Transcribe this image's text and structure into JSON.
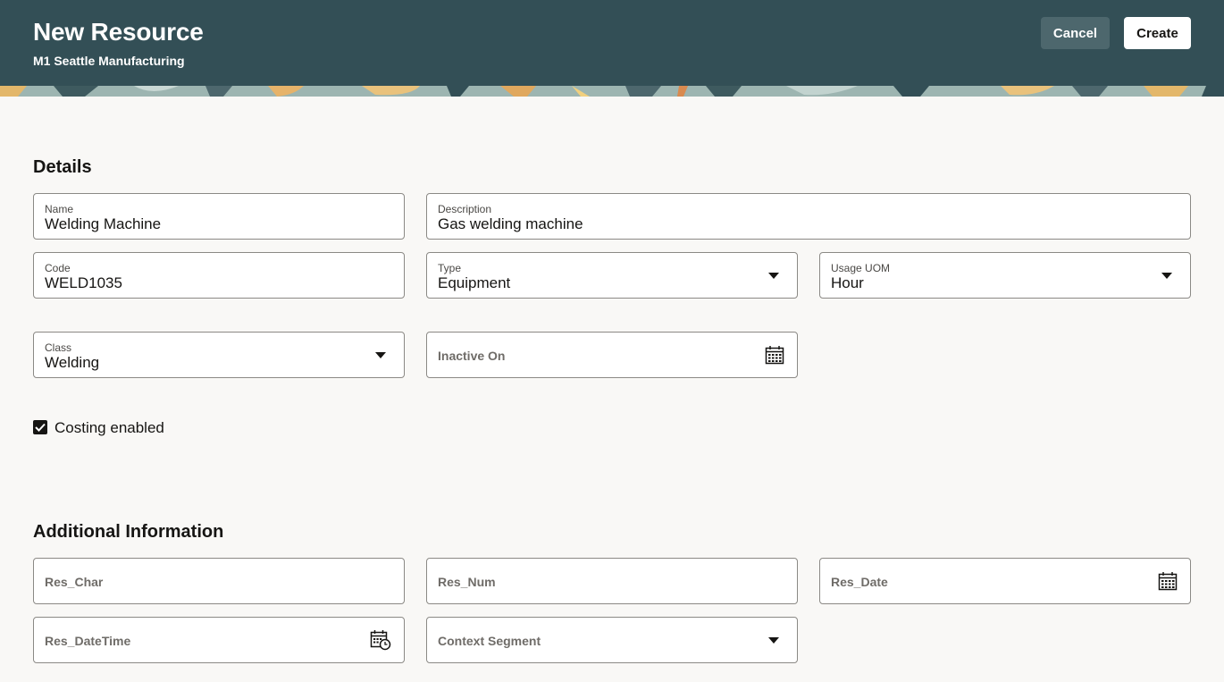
{
  "header": {
    "title": "New Resource",
    "subtitle": "M1 Seattle Manufacturing",
    "cancel_label": "Cancel",
    "create_label": "Create"
  },
  "details": {
    "title": "Details",
    "name": {
      "label": "Name",
      "value": "Welding Machine"
    },
    "description": {
      "label": "Description",
      "value": "Gas welding machine"
    },
    "code": {
      "label": "Code",
      "value": "WELD1035"
    },
    "type": {
      "label": "Type",
      "value": "Equipment"
    },
    "usage_uom": {
      "label": "Usage UOM",
      "value": "Hour"
    },
    "class": {
      "label": "Class",
      "value": "Welding"
    },
    "inactive_on": {
      "label": "Inactive On",
      "value": ""
    },
    "costing_enabled": {
      "label": "Costing enabled",
      "checked": true
    }
  },
  "additional": {
    "title": "Additional Information",
    "res_char": {
      "label": "Res_Char"
    },
    "res_num": {
      "label": "Res_Num"
    },
    "res_date": {
      "label": "Res_Date"
    },
    "res_datetime": {
      "label": "Res_DateTime"
    },
    "context_segment": {
      "label": "Context Segment"
    }
  },
  "colors": {
    "header_bg": "#334f56",
    "page_bg": "#f9f8f6",
    "field_border": "#8b8985"
  },
  "icons": [
    "calendar-icon",
    "calendar-clock-icon",
    "chevron-down-icon",
    "checkmark-icon"
  ]
}
